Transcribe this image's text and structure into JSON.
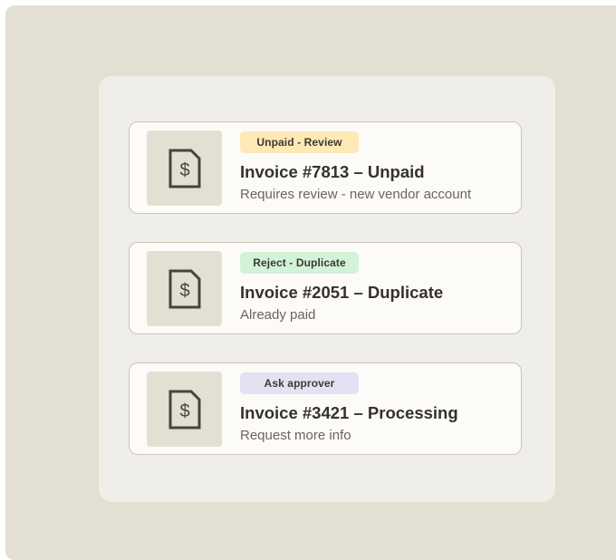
{
  "invoices": [
    {
      "badge": "Unpaid - Review",
      "badge_color": "#fde8b6",
      "title": "Invoice #7813 – Unpaid",
      "subtitle": "Requires review - new vendor account",
      "icon": "invoice-dollar-icon"
    },
    {
      "badge": "Reject - Duplicate",
      "badge_color": "#d2f3d8",
      "title": "Invoice #2051 – Duplicate",
      "subtitle": "Already paid",
      "icon": "invoice-dollar-icon"
    },
    {
      "badge": "Ask approver",
      "badge_color": "#e2e2f4",
      "title": "Invoice #3421 – Processing",
      "subtitle": "Request more info",
      "icon": "invoice-dollar-icon"
    }
  ],
  "colors": {
    "backdrop": "#e4dfd3",
    "panel": "#efeee9",
    "card": "#fcfbf7",
    "icon_stroke": "#48443c"
  }
}
